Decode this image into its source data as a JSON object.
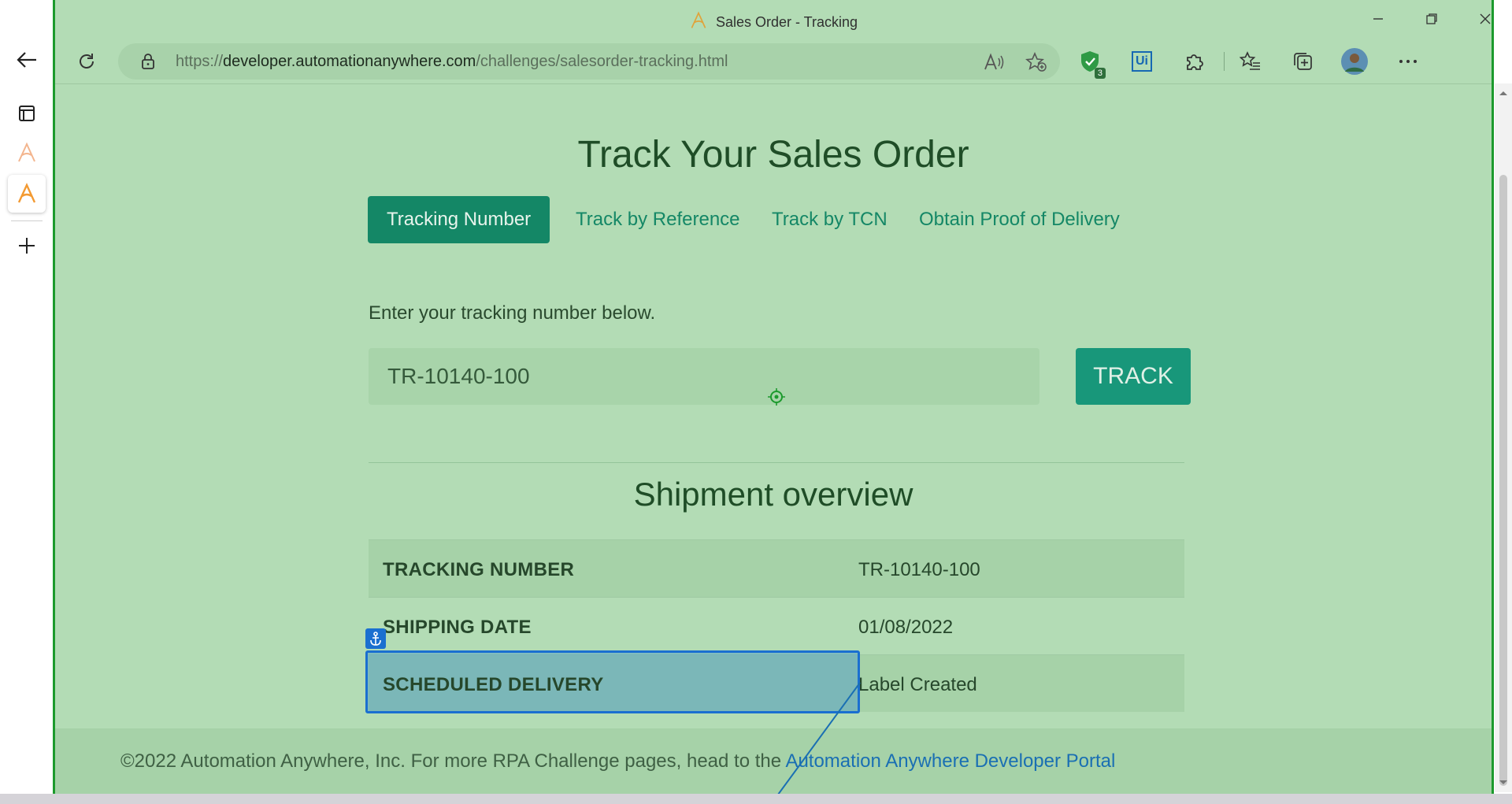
{
  "window": {
    "title": "Sales Order - Tracking"
  },
  "address_bar": {
    "url_scheme": "https://",
    "url_host": "developer.automationanywhere.com",
    "url_path": "/challenges/salesorder-tracking.html"
  },
  "extensions": {
    "shield_badge_count": "3",
    "uipath_label": "Ui"
  },
  "page": {
    "heading": "Track Your Sales Order",
    "tabs": [
      {
        "label": "Tracking Number",
        "active": true
      },
      {
        "label": "Track by Reference",
        "active": false
      },
      {
        "label": "Track by TCN",
        "active": false
      },
      {
        "label": "Obtain Proof of Delivery",
        "active": false
      }
    ],
    "prompt": "Enter your tracking number below.",
    "tracking_input_value": "TR-10140-100",
    "track_button": "TRACK",
    "overview_heading": "Shipment overview",
    "overview_rows": [
      {
        "key": "TRACKING NUMBER",
        "value": "TR-10140-100"
      },
      {
        "key": "SHIPPING DATE",
        "value": "01/08/2022"
      },
      {
        "key": "SCHEDULED DELIVERY",
        "value": "Label Created"
      }
    ],
    "footer_text": "©2022 Automation Anywhere, Inc. For more RPA Challenge pages, head to the ",
    "footer_link": "Automation Anywhere Developer Portal"
  },
  "colors": {
    "overlay_green": "#b3dcb5",
    "brand_teal": "#148766",
    "selection_blue": "#1a6fd0",
    "link_blue": "#1a6fb3"
  }
}
